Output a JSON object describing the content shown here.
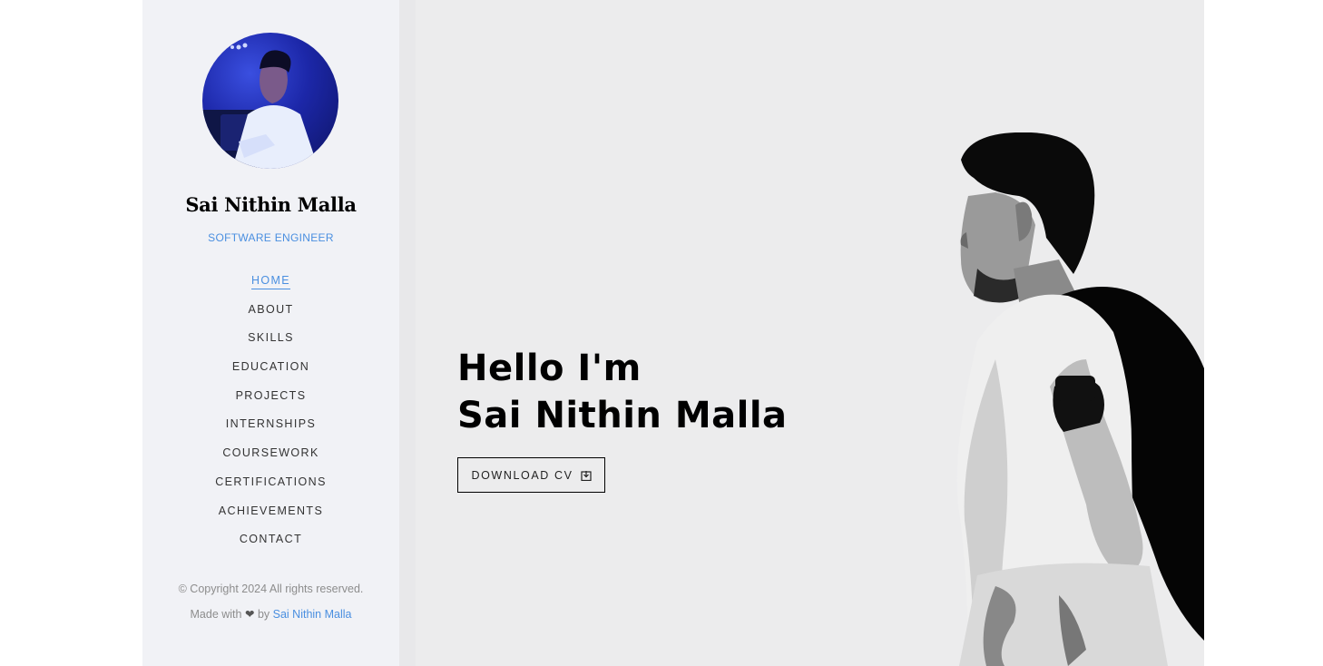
{
  "sidebar": {
    "name": "Sai Nithin Malla",
    "title": "SOFTWARE ENGINEER",
    "nav": [
      {
        "label": "HOME",
        "active": true
      },
      {
        "label": "ABOUT"
      },
      {
        "label": "SKILLS"
      },
      {
        "label": "EDUCATION"
      },
      {
        "label": "PROJECTS"
      },
      {
        "label": "INTERNSHIPS"
      },
      {
        "label": "COURSEWORK"
      },
      {
        "label": "CERTIFICATIONS"
      },
      {
        "label": "ACHIEVEMENTS"
      },
      {
        "label": "CONTACT"
      }
    ],
    "footer": {
      "copyright": "© Copyright 2024 All rights reserved.",
      "made_with": "Made with",
      "heart": "❤",
      "by": "by",
      "author_link": "Sai Nithin Malla"
    }
  },
  "hero": {
    "line1": "Hello I'm",
    "line2": "Sai Nithin Malla",
    "cv_button": "DOWNLOAD CV",
    "cv_icon": "download-icon"
  },
  "colors": {
    "accent": "#4a8fe0",
    "sidebar_bg": "#f1f2f6",
    "hero_bg": "#ececed"
  }
}
